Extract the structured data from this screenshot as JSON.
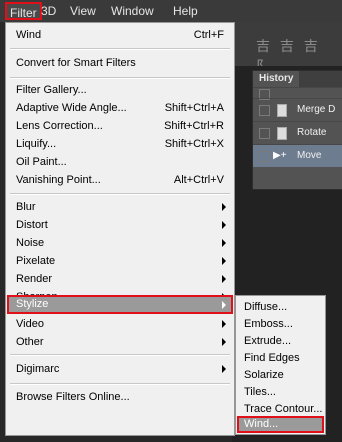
{
  "menubar": {
    "items": [
      "Filter",
      "3D",
      "View",
      "Window",
      "Help"
    ]
  },
  "toolbar": {
    "glyphs": "吉 吉 吉 阝"
  },
  "history": {
    "tab": "History",
    "rows": [
      "Merge D",
      "Rotate",
      "Move"
    ]
  },
  "filter_menu": {
    "wind": "Wind",
    "wind_sc": "Ctrl+F",
    "convert": "Convert for Smart Filters",
    "gallery": "Filter Gallery...",
    "adaptive": "Adaptive Wide Angle...",
    "adaptive_sc": "Shift+Ctrl+A",
    "lens": "Lens Correction...",
    "lens_sc": "Shift+Ctrl+R",
    "liquify": "Liquify...",
    "liquify_sc": "Shift+Ctrl+X",
    "oil": "Oil Paint...",
    "vanishing": "Vanishing Point...",
    "vanishing_sc": "Alt+Ctrl+V",
    "blur": "Blur",
    "distort": "Distort",
    "noise": "Noise",
    "pixelate": "Pixelate",
    "render": "Render",
    "sharpen": "Sharpen",
    "stylize": "Stylize",
    "video": "Video",
    "other": "Other",
    "digimarc": "Digimarc",
    "browse": "Browse Filters Online..."
  },
  "stylize_submenu": {
    "items": [
      "Diffuse...",
      "Emboss...",
      "Extrude...",
      "Find Edges",
      "Solarize",
      "Tiles...",
      "Trace Contour...",
      "Wind..."
    ]
  },
  "colors": {
    "highlight_border": "#e0101b",
    "highlight_bg": "#9a9a9a"
  }
}
